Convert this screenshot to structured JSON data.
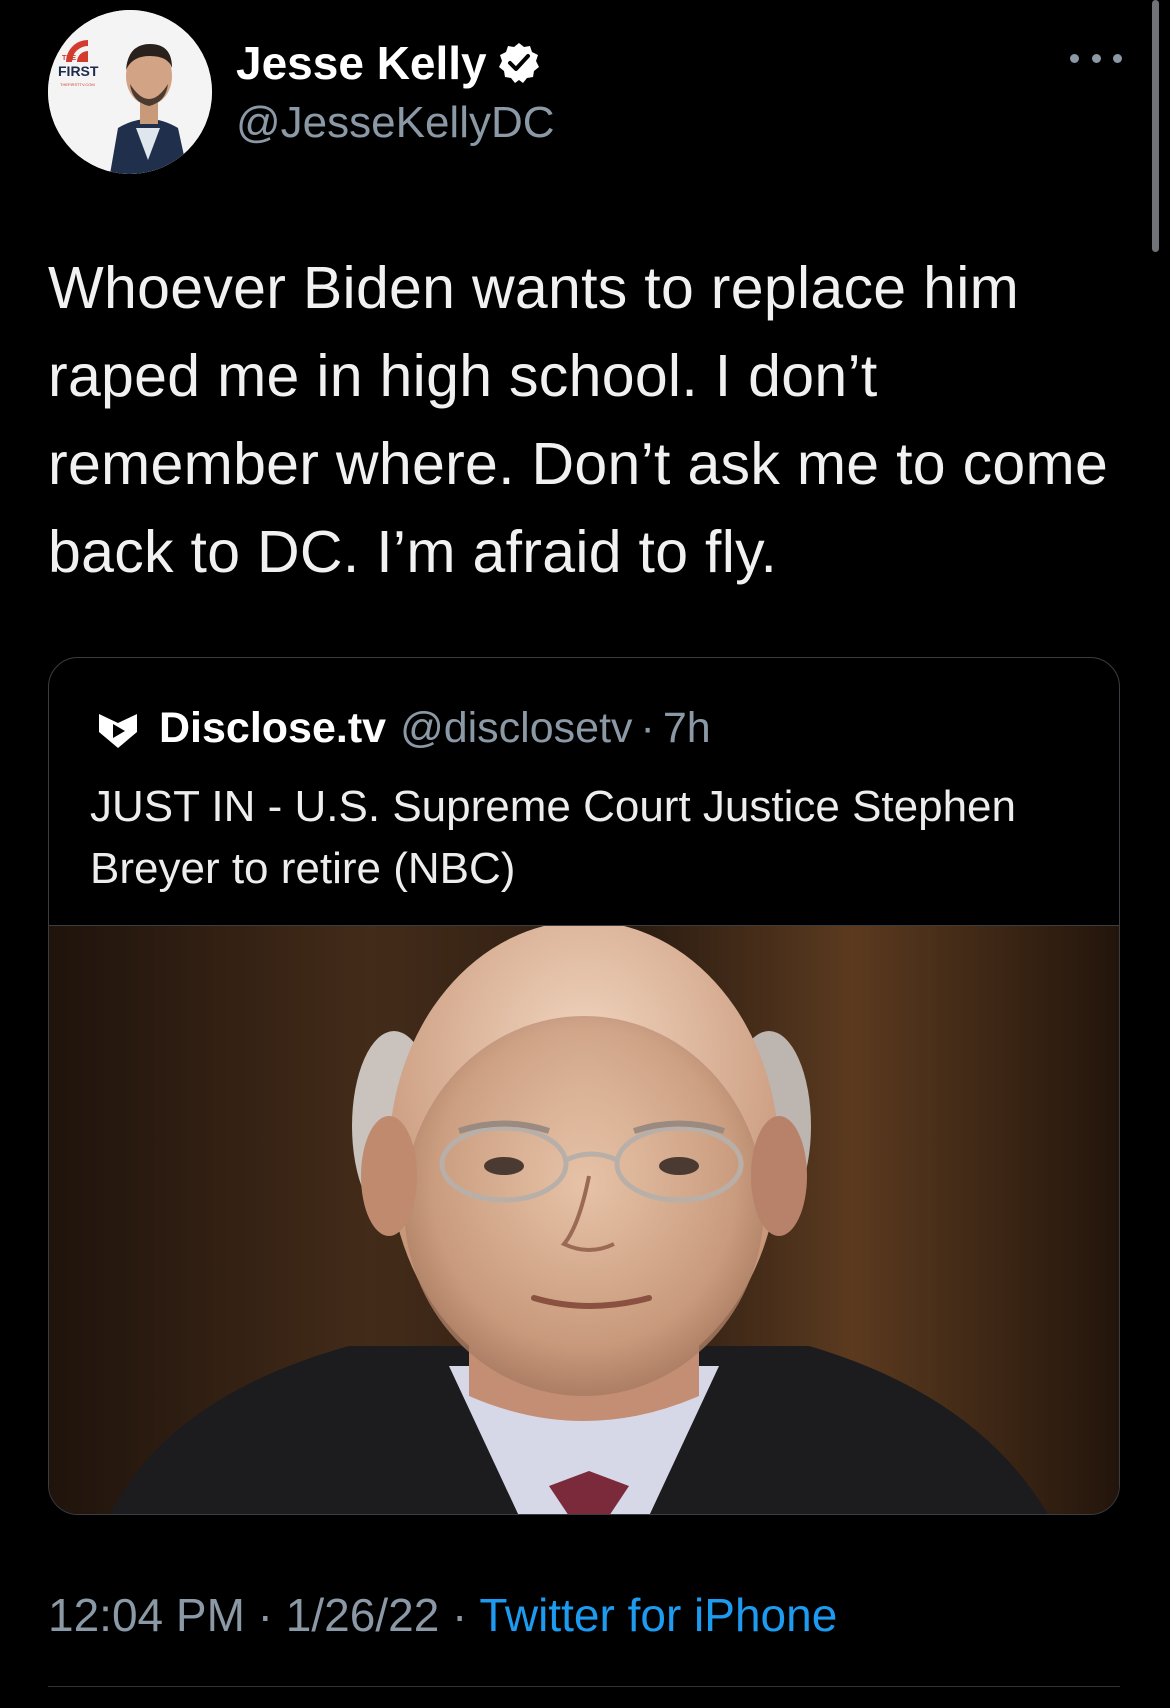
{
  "tweet": {
    "author": {
      "name": "Jesse Kelly",
      "handle": "@JesseKellyDC",
      "avatar_badge": {
        "logo_top": "THE",
        "logo_main": "FIRST",
        "logo_url": "THEFIRSTTV.COM"
      }
    },
    "text": "Whoever Biden wants to replace him raped me in high school. I don’t remember where. Don’t ask me to come back to DC. I’m afraid to fly.",
    "quote": {
      "name": "Disclose.tv",
      "handle": "@disclosetv",
      "separator": "·",
      "time": "7h",
      "text": "JUST IN - U.S. Supreme Court Justice Stephen Breyer to retire (NBC)"
    },
    "meta": {
      "time": "12:04 PM",
      "sep1": " · ",
      "date": "1/26/22",
      "sep2": " · ",
      "source": "Twitter for iPhone"
    }
  },
  "icons": {
    "verified": "verified-badge-icon",
    "more": "more-options-icon",
    "quote_avatar": "disclose-logo-icon"
  },
  "colors": {
    "background": "#000000",
    "link": "#1d9bf0",
    "secondary_text": "#8b98a5",
    "primary_text": "#e7e9ea"
  }
}
